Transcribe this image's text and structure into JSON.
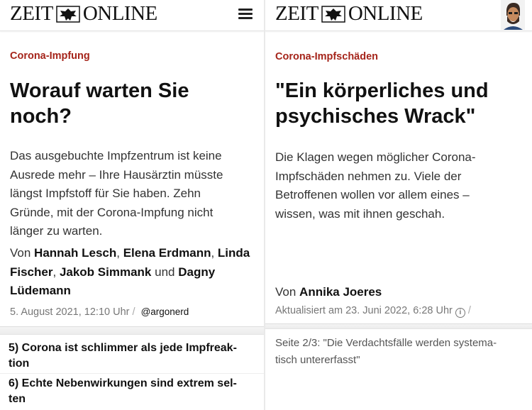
{
  "brand": {
    "logo_left": "ZEIT",
    "logo_right": "ONLINE"
  },
  "left": {
    "kicker": "Corona-Impfung",
    "headline_line1": "Worauf warten Sie",
    "headline_line2": "noch?",
    "teaser_lines": [
      "Das ausgebuchte Impfzentrum ist keine",
      "Ausrede mehr – Ihre Hausärztin müsste",
      "längst Impfstoff für Sie haben. Zehn",
      "Gründe, mit der Corona-Impfung nicht",
      "länger zu warten."
    ],
    "byline": {
      "prefix": "Von",
      "author1": "Hannah Lesch",
      "author2": "Elena Erdmann",
      "author3": "Linda Fischer",
      "author4": "Jakob Simmank",
      "conj": "und",
      "author5": "Dagny Lüdemann"
    },
    "date": "5. August 2021, 12:10 Uhr",
    "slash": "/",
    "handle": "@argonerd",
    "toc": [
      {
        "line1": "5) Corona ist schlimmer als jede Impfreak-",
        "line2": "tion"
      },
      {
        "line1": "6) Echte Nebenwirkungen sind extrem sel-",
        "line2": "ten"
      }
    ]
  },
  "right": {
    "kicker": "Corona-Impfschäden",
    "headline_line1": "\"Ein körperliches und",
    "headline_line2": "psychisches Wrack\"",
    "teaser_lines": [
      "Die Klagen wegen möglicher Corona-",
      "Impfschäden nehmen zu. Viele der",
      "Betroffenen wollen vor allem eines –",
      "wissen, was mit ihnen geschah."
    ],
    "byline": {
      "prefix": "Von",
      "author": "Annika Joeres"
    },
    "updated": "Aktualisiert am 23. Juni 2022, 6:28 Uhr",
    "info_symbol": "i",
    "slash": "/",
    "page_note_line1": "Seite 2/3: \"Die Verdachtsfälle werden systema-",
    "page_note_line2": "tisch untererfasst\""
  },
  "colors": {
    "kicker": "#a5241a",
    "text": "#333333",
    "meta": "#777777"
  },
  "icons": {
    "menu": "hamburger-menu-icon",
    "avatar": "user-avatar-icon",
    "logo_emblem": "eagle-emblem-icon"
  }
}
